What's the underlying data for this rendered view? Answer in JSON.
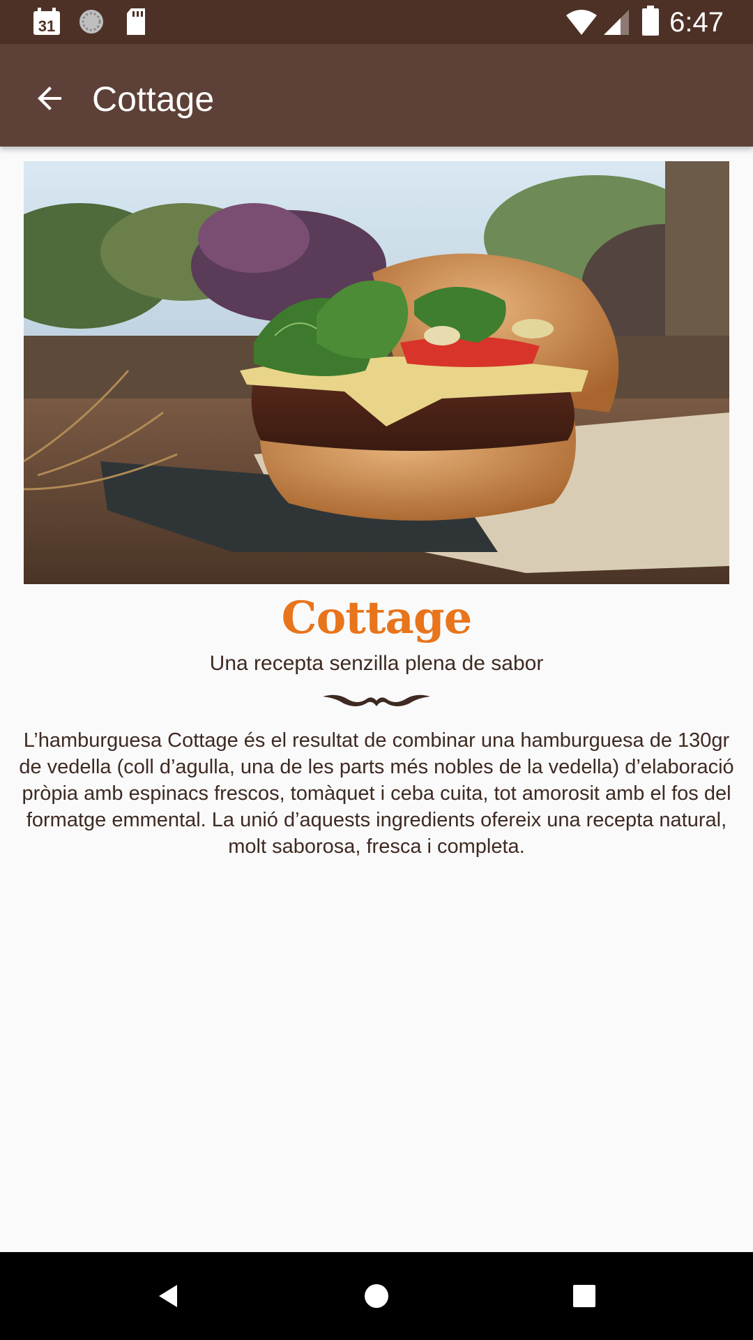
{
  "status_bar": {
    "time": "6:47",
    "calendar_day": "31",
    "icons": [
      "calendar-icon",
      "sync-icon",
      "sd-card-icon",
      "wifi-icon",
      "signal-icon",
      "battery-icon"
    ]
  },
  "app_bar": {
    "title": "Cottage",
    "back_icon": "arrow-back-icon",
    "background": "#5d4037"
  },
  "content": {
    "image_alt": "Cottage burger",
    "title": "Cottage",
    "subtitle": "Una recepta senzilla plena de sabor",
    "description": "L’hamburguesa Cottage és el resultat de combinar una hamburguesa de 130gr de vedella (coll d’agulla, una de les parts més nobles de la vedella) d’elaboració pròpia amb espinacs frescos, tomàquet i ceba cuita, tot amorosit amb el fos del formatge emmental. La unió d’aquests ingredients ofereix una recepta natural, molt saborosa, fresca i completa.",
    "title_color": "#e8741b"
  },
  "nav_bar": {
    "back": "nav-back-icon",
    "home": "nav-home-icon",
    "recents": "nav-recents-icon"
  }
}
